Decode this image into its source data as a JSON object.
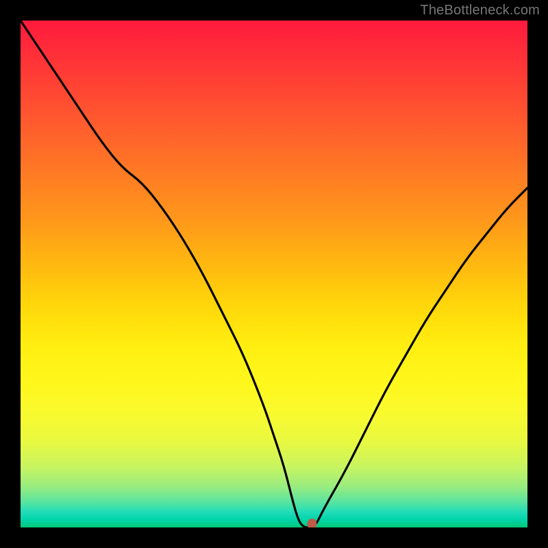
{
  "watermark": "TheBottleneck.com",
  "chart_data": {
    "type": "line",
    "title": "",
    "xlabel": "",
    "ylabel": "",
    "xlim": [
      0,
      100
    ],
    "ylim": [
      0,
      100
    ],
    "grid": false,
    "series": [
      {
        "name": "bottleneck-curve",
        "color": "#000000",
        "x": [
          0,
          4,
          8,
          12,
          16,
          20,
          24,
          28,
          32,
          36,
          40,
          44,
          48,
          50,
          52,
          54,
          55,
          56,
          57,
          58,
          60,
          64,
          68,
          72,
          76,
          80,
          84,
          88,
          92,
          96,
          100
        ],
        "y": [
          100,
          94,
          88,
          82,
          76,
          71,
          68,
          63,
          57,
          50,
          42,
          34,
          24,
          18,
          12,
          4,
          1,
          0,
          0,
          0,
          4,
          11,
          19,
          27,
          34,
          41,
          47,
          53,
          58,
          63,
          67
        ]
      }
    ],
    "marker": {
      "x": 57.5,
      "y": 0,
      "color": "#bf5a48"
    }
  }
}
